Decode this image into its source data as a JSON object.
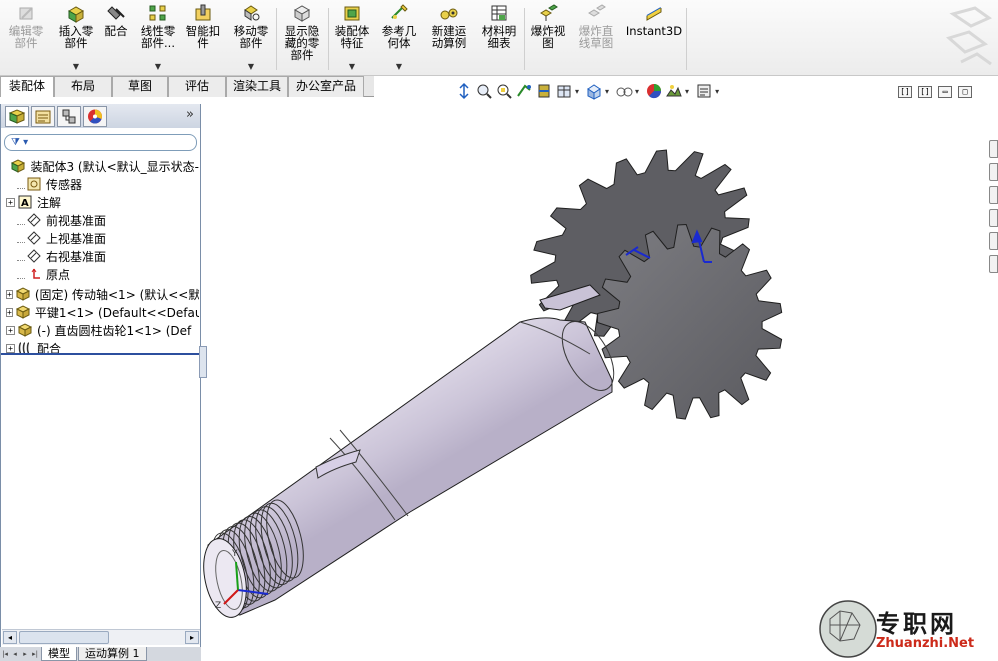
{
  "command_manager": {
    "buttons": [
      {
        "label": "编辑零\n部件",
        "icon": "edit-component-icon",
        "disabled": true,
        "dropdown": false
      },
      {
        "label": "插入零\n部件",
        "icon": "insert-component-icon",
        "disabled": false,
        "dropdown": true
      },
      {
        "label": "配合",
        "icon": "mate-icon",
        "disabled": false,
        "dropdown": false
      },
      {
        "label": "线性零\n部件...",
        "icon": "linear-pattern-icon",
        "disabled": false,
        "dropdown": true
      },
      {
        "label": "智能扣\n件",
        "icon": "smart-fasteners-icon",
        "disabled": false,
        "dropdown": false
      },
      {
        "label": "移动零\n部件",
        "icon": "move-component-icon",
        "disabled": false,
        "dropdown": true
      },
      {
        "label": "显示隐\n藏的零\n部件",
        "icon": "show-hidden-icon",
        "disabled": false,
        "dropdown": false
      },
      {
        "label": "装配体\n特征",
        "icon": "assembly-features-icon",
        "disabled": false,
        "dropdown": true
      },
      {
        "label": "参考几\n何体",
        "icon": "reference-geometry-icon",
        "disabled": false,
        "dropdown": true
      },
      {
        "label": "新建运\n动算例",
        "icon": "new-motion-study-icon",
        "disabled": false,
        "dropdown": false
      },
      {
        "label": "材料明\n细表",
        "icon": "bill-of-materials-icon",
        "disabled": false,
        "dropdown": false
      },
      {
        "label": "爆炸视\n图",
        "icon": "exploded-view-icon",
        "disabled": false,
        "dropdown": false
      },
      {
        "label": "爆炸直\n线草图",
        "icon": "explode-line-sketch-icon",
        "disabled": true,
        "dropdown": false
      },
      {
        "label": "Instant3D",
        "icon": "instant3d-icon",
        "disabled": false,
        "dropdown": false
      }
    ]
  },
  "tabs": [
    "装配体",
    "布局",
    "草图",
    "评估",
    "渲染工具",
    "办公室产品"
  ],
  "active_tab": 0,
  "view_toolbar": [
    "view-orientation-icon",
    "zoom-to-fit-icon",
    "zoom-area-icon",
    "previous-view-icon",
    "section-view-icon",
    "view-orientation-dropdown-icon",
    "display-style-icon",
    "hide-show-icon",
    "edit-appearance-icon",
    "apply-scene-icon",
    "view-settings-icon"
  ],
  "feature_tree": {
    "filter_icon": "filter-icon",
    "items": [
      {
        "label": "装配体3  (默认<默认_显示状态-",
        "icon": "assembly-icon",
        "expand": "none",
        "indent": 0
      },
      {
        "label": "传感器",
        "icon": "sensor-icon",
        "expand": "none",
        "indent": 1
      },
      {
        "label": "注解",
        "icon": "annotation-icon",
        "expand": "+",
        "indent": 1
      },
      {
        "label": "前视基准面",
        "icon": "plane-icon",
        "expand": "none",
        "indent": 1
      },
      {
        "label": "上视基准面",
        "icon": "plane-icon",
        "expand": "none",
        "indent": 1
      },
      {
        "label": "右视基准面",
        "icon": "plane-icon",
        "expand": "none",
        "indent": 1
      },
      {
        "label": "原点",
        "icon": "origin-icon",
        "expand": "none",
        "indent": 1
      },
      {
        "label": "(固定) 传动轴<1> (默认<<默",
        "icon": "part-icon",
        "expand": "+",
        "indent": 1
      },
      {
        "label": "平键1<1> (Default<<Defaul",
        "icon": "part-icon",
        "expand": "+",
        "indent": 1
      },
      {
        "label": "(-) 直齿圆柱齿轮1<1> (Def",
        "icon": "part-icon",
        "expand": "+",
        "indent": 1
      },
      {
        "label": "配合",
        "icon": "mates-icon",
        "expand": "+",
        "indent": 1
      }
    ]
  },
  "bottom_tabs": [
    "模型",
    "运动算例 1"
  ],
  "active_bottom_tab": 0,
  "watermark": {
    "text": "专职网",
    "url": "Zhuanzhi.Net"
  },
  "colors": {
    "accent": "#2c4f9e",
    "shaft": "#d9d5e6",
    "gear": "#6f6f73"
  }
}
